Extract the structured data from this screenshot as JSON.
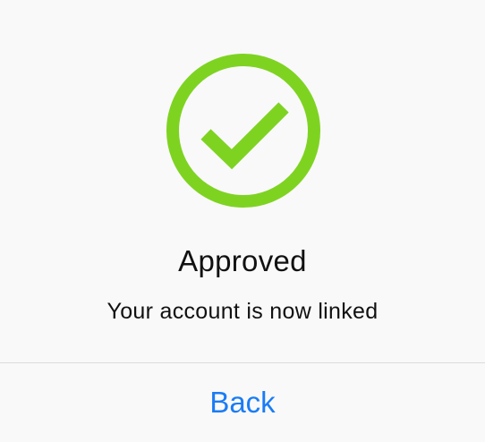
{
  "dialog": {
    "icon": "checkmark-circle-icon",
    "accent_color": "#7ed321",
    "title": "Approved",
    "message": "Your account is now linked",
    "back_label": "Back",
    "button_color": "#1a7cf5"
  }
}
